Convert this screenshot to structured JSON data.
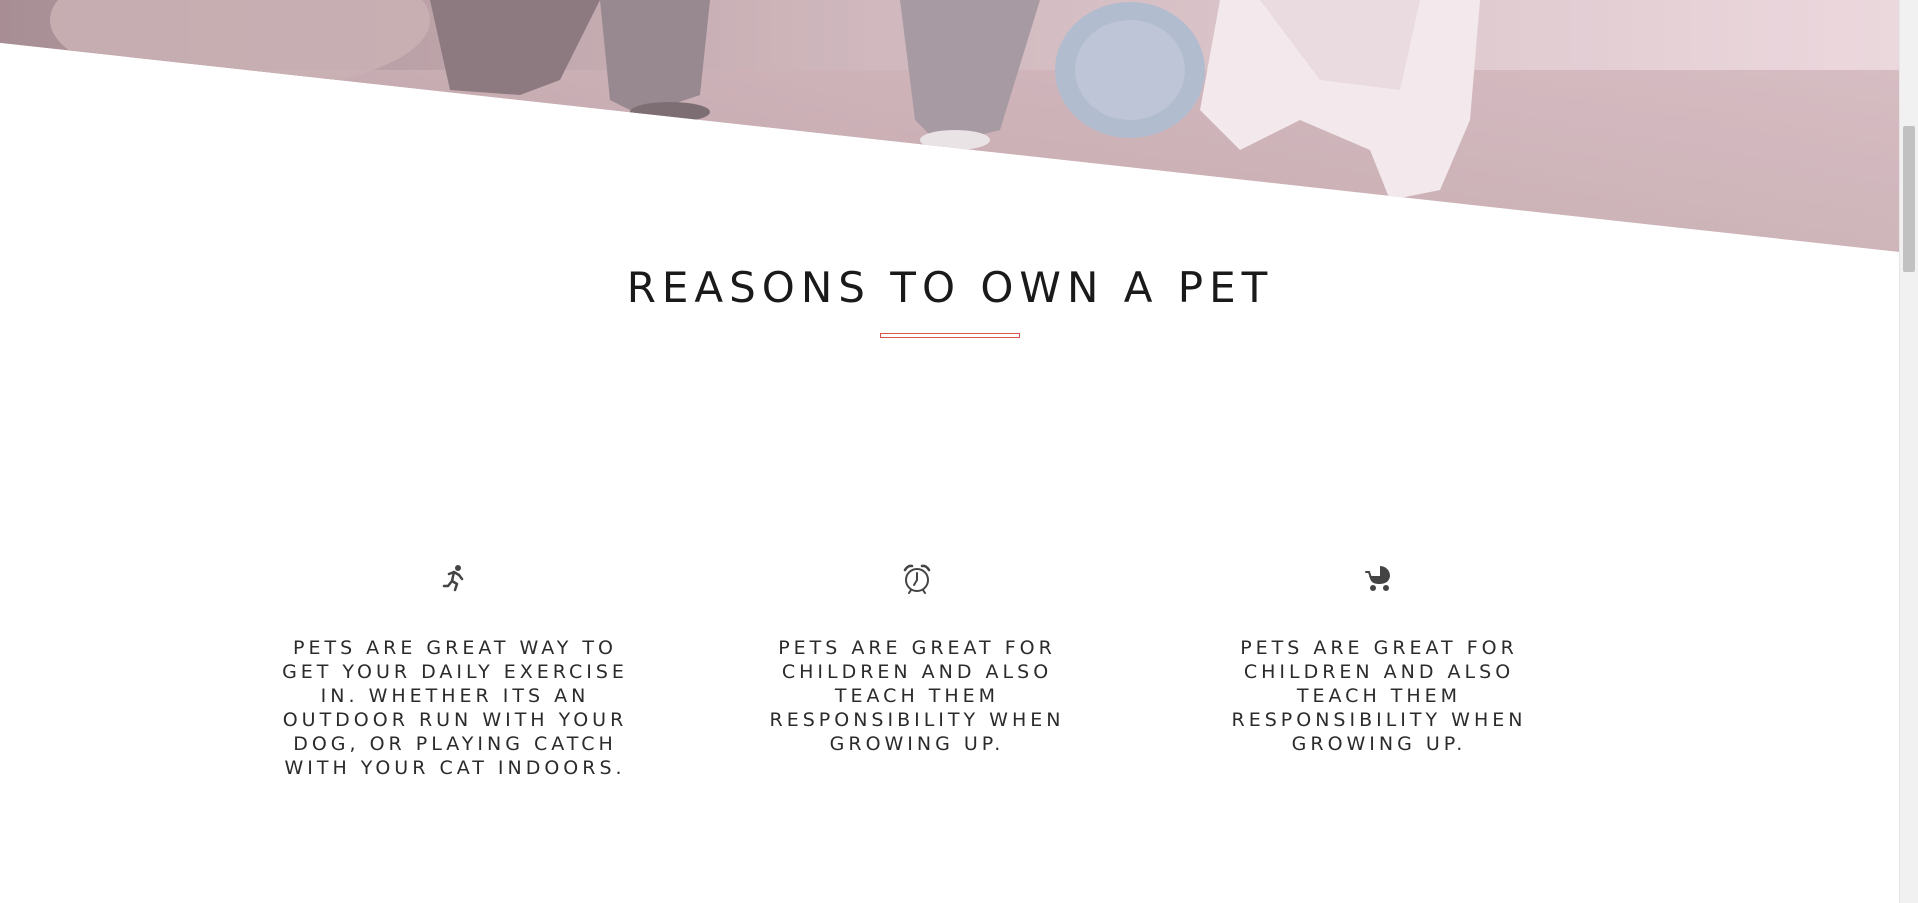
{
  "hero": {
    "image": "woman-with-dog-photo"
  },
  "section": {
    "title": "REASONS TO OWN A PET",
    "accent_color": "#d9534f"
  },
  "features": [
    {
      "icon": "running-person-icon",
      "text": "PETS ARE GREAT WAY TO GET YOUR DAILY EXERCISE IN. WHETHER ITS AN OUTDOOR RUN WITH YOUR DOG, OR PLAYING CATCH WITH YOUR CAT INDOORS."
    },
    {
      "icon": "alarm-clock-icon",
      "text": "PETS ARE GREAT FOR CHILDREN AND ALSO TEACH THEM RESPONSIBILITY WHEN GROWING UP."
    },
    {
      "icon": "baby-stroller-icon",
      "text": "PETS ARE GREAT FOR CHILDREN AND ALSO TEACH THEM RESPONSIBILITY WHEN GROWING UP."
    }
  ]
}
